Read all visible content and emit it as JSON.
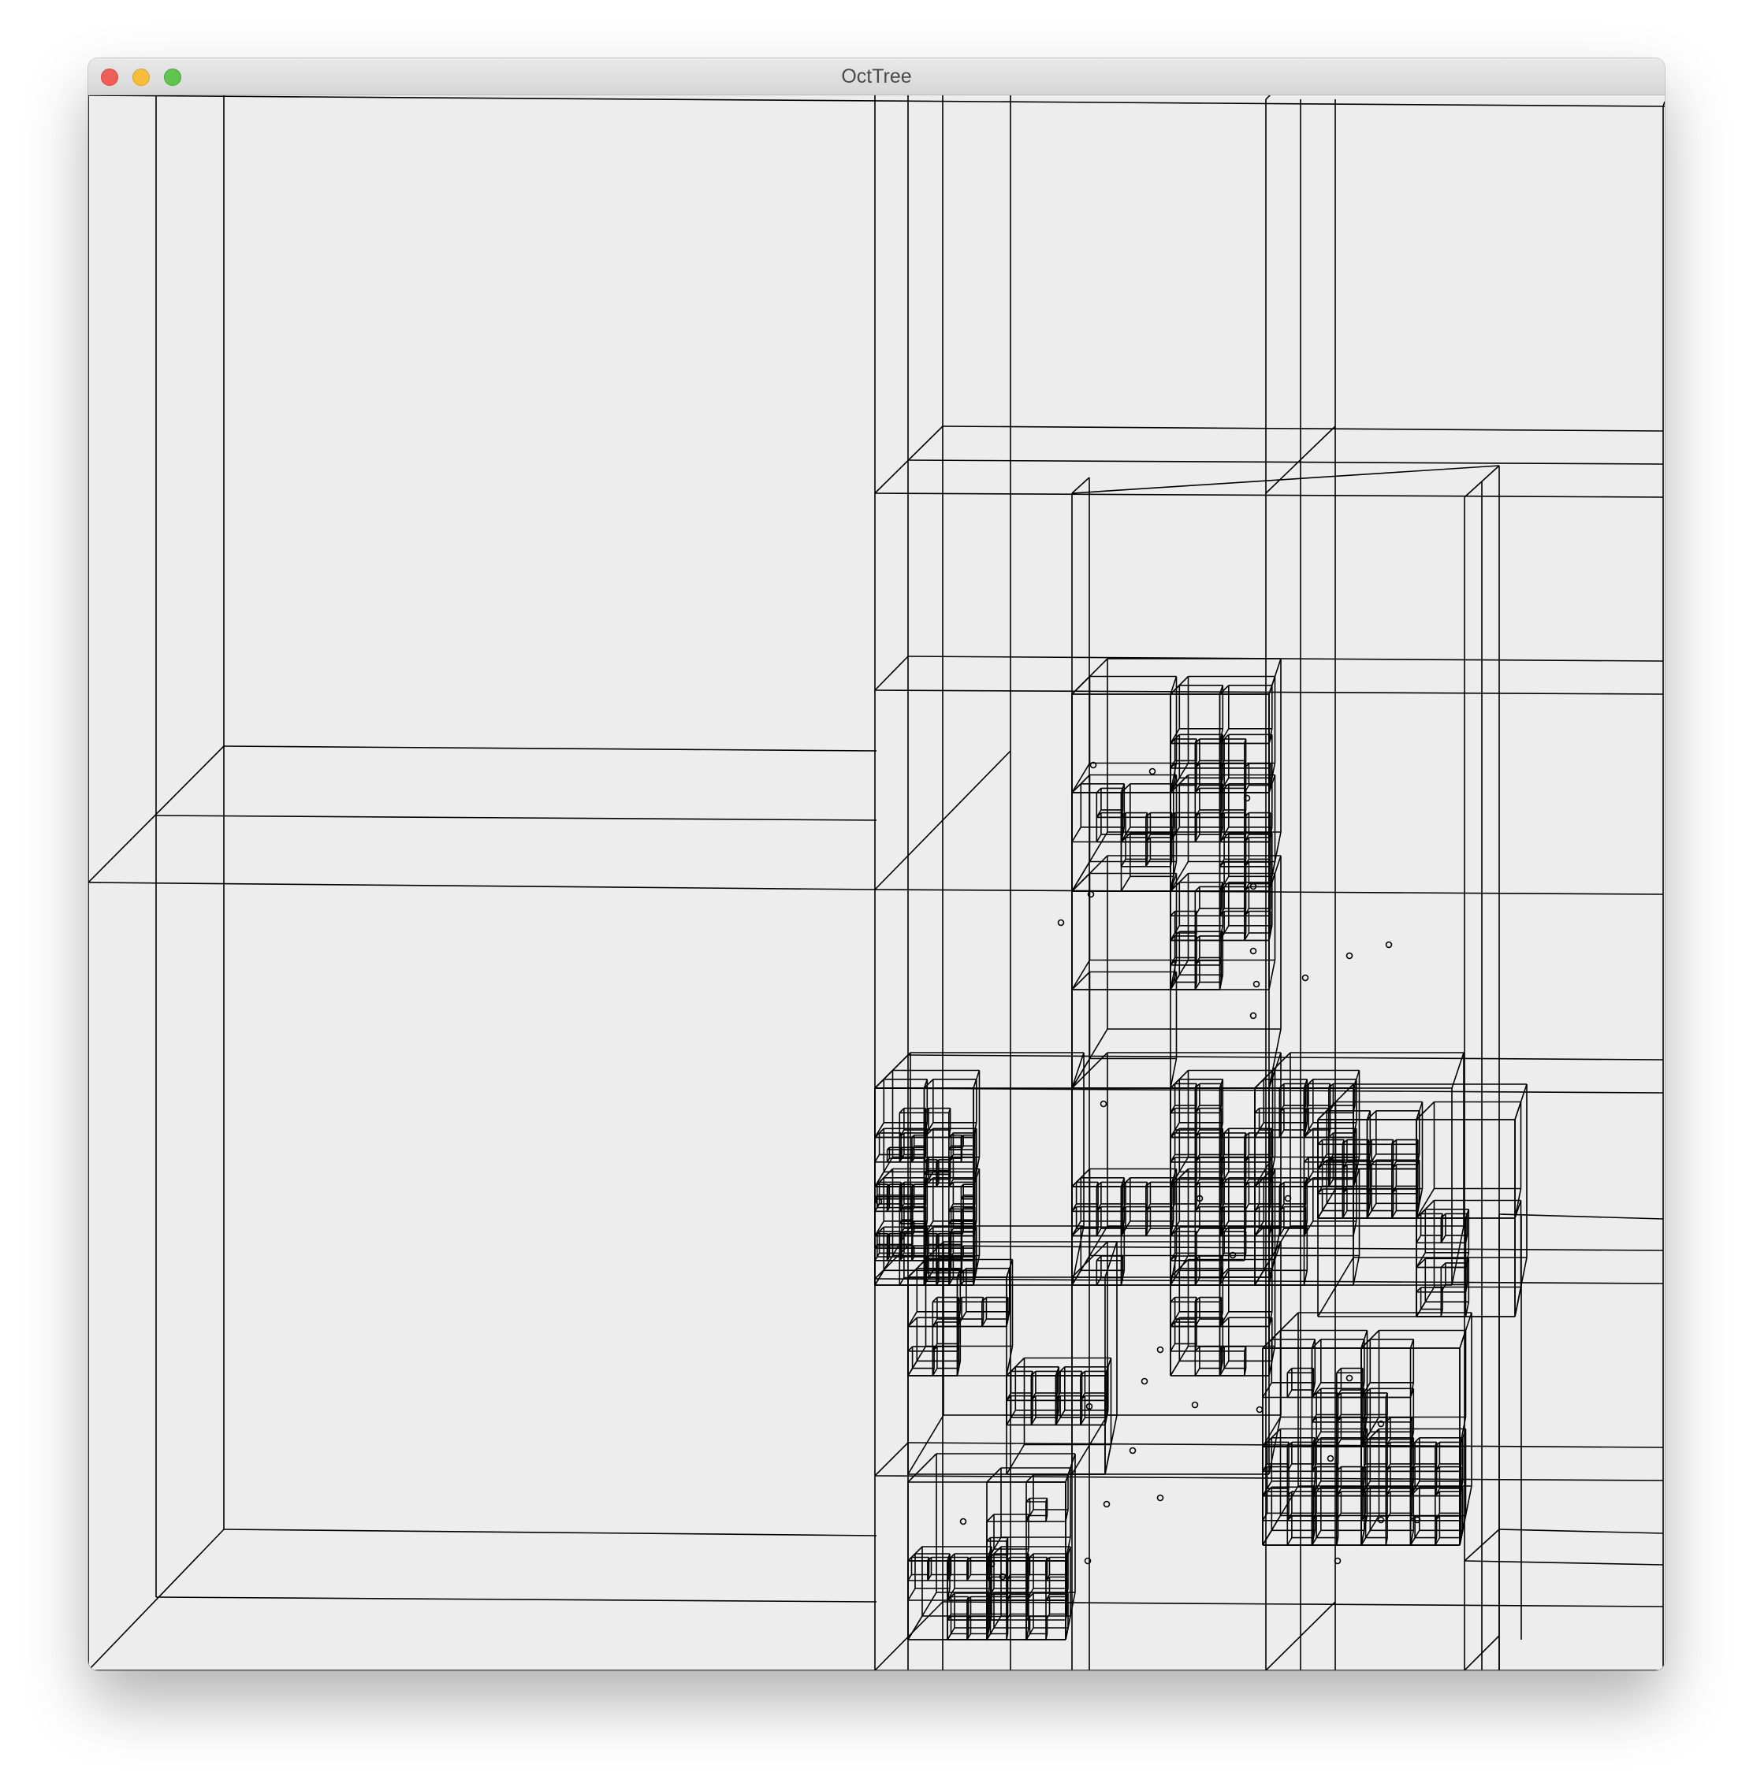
{
  "window": {
    "title": "OctTree",
    "buttons": [
      "close",
      "minimize",
      "zoom"
    ]
  },
  "canvas": {
    "icon": "octree-wireframe",
    "stroke_color": "#000000",
    "background_color": "#ededed"
  }
}
